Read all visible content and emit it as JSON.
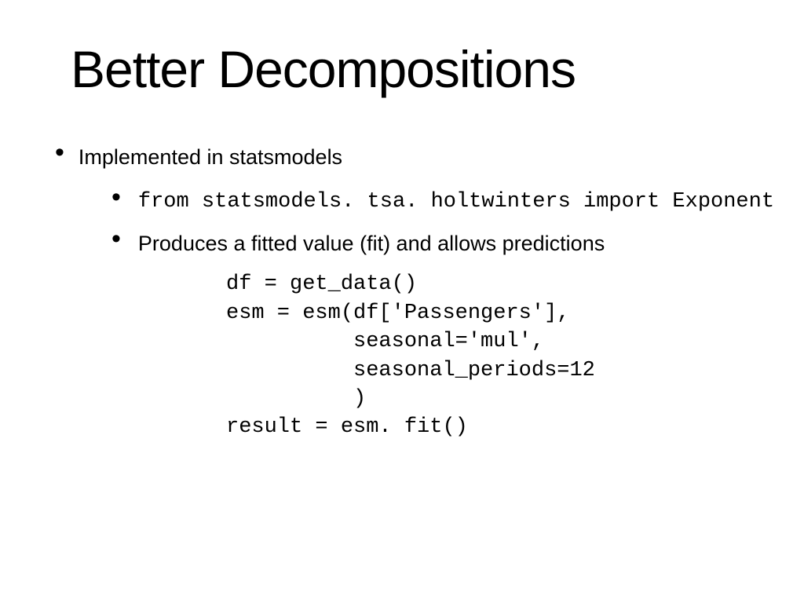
{
  "slide": {
    "title": "Better Decompositions",
    "bullets": [
      {
        "text": "Implemented in statsmodels",
        "sub": [
          {
            "code": "from statsmodels. tsa. holtwinters import Exponent"
          },
          {
            "text": "Produces a fitted value (fit) and allows predictions"
          }
        ]
      }
    ],
    "code_block": "df = get_data()\nesm = esm(df['Passengers'],\n          seasonal='mul',\n          seasonal_periods=12\n          )\nresult = esm. fit()"
  }
}
